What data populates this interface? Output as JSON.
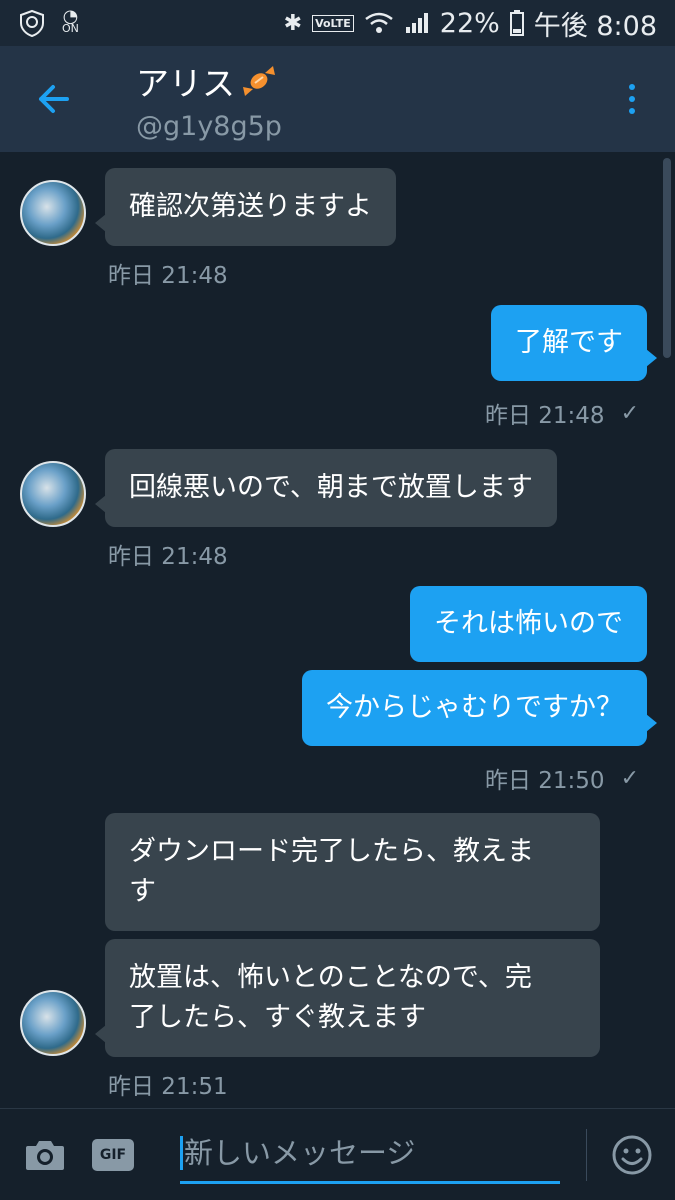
{
  "status_bar": {
    "on_label": "ON",
    "volte": "VoLTE",
    "battery": "22%",
    "time": "午後 8:08"
  },
  "header": {
    "name": "アリス",
    "handle": "@g1y8g5p"
  },
  "messages": [
    {
      "dir": "in",
      "text": "確認次第送りますよ",
      "meta": "昨日 21:48"
    },
    {
      "dir": "out",
      "text": "了解です",
      "meta": "昨日 21:48"
    },
    {
      "dir": "in",
      "text": "回線悪いので、朝まで放置します",
      "meta": "昨日 21:48"
    },
    {
      "dir": "out",
      "text": "それは怖いので"
    },
    {
      "dir": "out",
      "text": "今からじゃむりですか？",
      "meta": "昨日 21:50"
    },
    {
      "dir": "in",
      "line1": "ダウンロード完了したら、教えま",
      "line2": "す"
    },
    {
      "dir": "in",
      "line1": "放置は、怖いとのことなので、完",
      "line2": "了したら、すぐ教えます",
      "meta": "昨日 21:51"
    }
  ],
  "composer": {
    "gif_label": "GIF",
    "placeholder": "新しいメッセージ"
  },
  "colors": {
    "accent": "#1da1f2",
    "background": "#15202b",
    "header": "#243447",
    "bubble_in": "#38444d",
    "muted": "#8899a6"
  },
  "icons": [
    "back-arrow-icon",
    "overflow-menu-icon",
    "candy-icon",
    "camera-icon",
    "emoji-icon",
    "read-check-icon"
  ]
}
